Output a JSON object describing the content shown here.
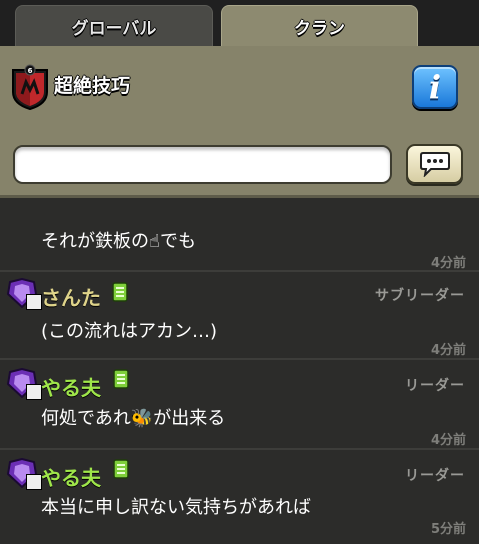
{
  "tabs": {
    "global_label": "グローバル",
    "clan_label": "クラン"
  },
  "clan": {
    "name": "超絶技巧",
    "badge_level": "6"
  },
  "input": {
    "value": ""
  },
  "colors": {
    "author_yellow": "#dfd48a",
    "author_green": "#9fe64a",
    "panel": "#86836a"
  },
  "messages": [
    {
      "text": "それが鉄板の☝でも",
      "time": "4分前"
    },
    {
      "author": "さんた",
      "role": "サブリーダー",
      "text": "(この流れはアカン…)",
      "time": "4分前"
    },
    {
      "author": "やる夫",
      "role": "リーダー",
      "text": "何処であれ🐝が出来る",
      "time": "4分前"
    },
    {
      "author": "やる夫",
      "role": "リーダー",
      "text": "本当に申し訳ない気持ちがあれば",
      "time": "5分前"
    }
  ]
}
